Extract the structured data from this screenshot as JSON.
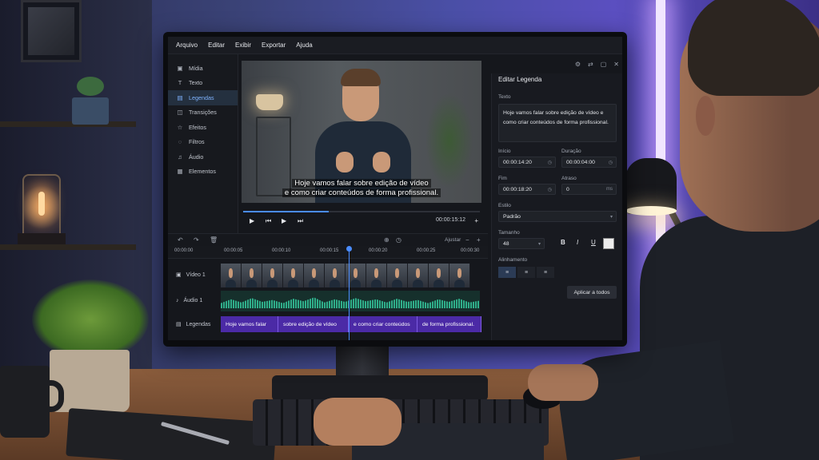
{
  "app": {
    "menu": [
      "Arquivo",
      "Editar",
      "Exibir",
      "Exportar",
      "Ajuda"
    ]
  },
  "sidebar": {
    "items": [
      {
        "label": "Mídia",
        "icon": "media-icon"
      },
      {
        "label": "Texto",
        "icon": "text-icon"
      },
      {
        "label": "Legendas",
        "icon": "subtitles-icon",
        "active": true
      },
      {
        "label": "Transições",
        "icon": "transitions-icon"
      },
      {
        "label": "Efeitos",
        "icon": "effects-icon"
      },
      {
        "label": "Filtros",
        "icon": "filters-icon"
      },
      {
        "label": "Áudio",
        "icon": "audio-icon"
      },
      {
        "label": "Elementos",
        "icon": "elements-icon"
      }
    ]
  },
  "preview": {
    "caption_line1": "Hoje vamos falar sobre edição de vídeo",
    "caption_line2": "e como criar conteúdos de forma profissional.",
    "timecode": "00:00:15:12",
    "progress": 0.36
  },
  "timeline": {
    "zoom_label": "Ajustar",
    "ruler": [
      "00:00:00",
      "00:00:05",
      "00:00:10",
      "00:00:15",
      "00:00:20",
      "00:00:25",
      "00:00:30"
    ],
    "tracks": {
      "video": "Vídeo 1",
      "audio": "Áudio 1",
      "subtitles": "Legendas"
    },
    "subtitle_clips": [
      "Hoje vamos falar",
      "sobre edição de vídeo",
      "e como criar conteúdos",
      "de forma profissional."
    ]
  },
  "panel": {
    "title": "Editar Legenda",
    "text_label": "Texto",
    "text_value": "Hoje vamos falar sobre edição de vídeo e como criar conteúdos de forma profissional.",
    "start_label": "Início",
    "start_value": "00:00:14:20",
    "duration_label": "Duração",
    "duration_value": "00:00:04:00",
    "end_label": "Fim",
    "end_value": "00:00:18:20",
    "delay_label": "Atraso",
    "delay_value": "0",
    "delay_unit": "ms",
    "style_label": "Estilo",
    "style_value": "Padrão",
    "size_label": "Tamanho",
    "size_value": "48",
    "bold": "B",
    "italic": "I",
    "underline": "U",
    "text_color": "#ececec",
    "align_label": "Alinhamento",
    "apply_button": "Aplicar a todos"
  },
  "colors": {
    "accent": "#4a8cff",
    "subtitle_clip": "#4b2aa6",
    "audio_wave": "#2fae8a"
  }
}
